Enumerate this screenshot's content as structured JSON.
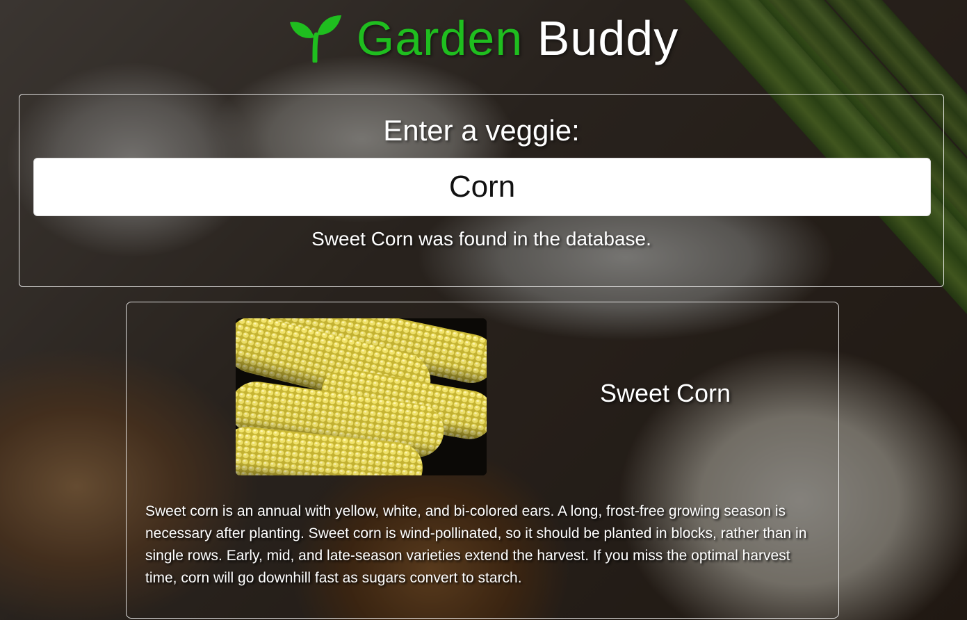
{
  "header": {
    "title_part1": "Garden",
    "title_part2": "Buddy",
    "logo_icon": "sprout-icon",
    "title_part1_color": "#1fbe1f",
    "title_part2_color": "#ffffff"
  },
  "search": {
    "label": "Enter a veggie:",
    "value": "Corn",
    "status": "Sweet Corn was found in the database."
  },
  "result": {
    "name": "Sweet Corn",
    "image_icon": "corn-photo",
    "description": "Sweet corn is an annual with yellow, white, and bi-colored ears. A long, frost-free growing season is necessary after planting. Sweet corn is wind-pollinated, so it should be planted in blocks, rather than in single rows. Early, mid, and late-season varieties extend the harvest. If you miss the optimal harvest time, corn will go downhill fast as sugars convert to starch."
  }
}
